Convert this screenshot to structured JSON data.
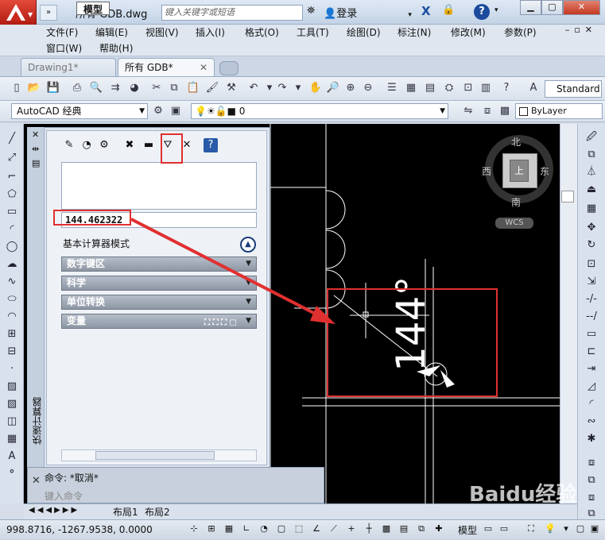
{
  "title_bar": {
    "doc_title": "所有 GDB.dwg",
    "search_placeholder": "键入关键字或短语",
    "login_label": "登录",
    "help_label": "?"
  },
  "menu": {
    "row1": [
      "文件(F)",
      "编辑(E)",
      "视图(V)",
      "插入(I)",
      "格式(O)",
      "工具(T)",
      "绘图(D)",
      "标注(N)",
      "修改(M)",
      "参数(P)"
    ],
    "row2": [
      "窗口(W)",
      "帮助(H)"
    ]
  },
  "tabs": [
    {
      "label": "Drawing1*"
    },
    {
      "label": "所有 GDB*"
    }
  ],
  "toolbar": {
    "text_style": "Standard",
    "workspace": "AutoCAD 经典",
    "layer": "0",
    "color": "ByLayer"
  },
  "calculator": {
    "palette_title": "快速计算器",
    "input_value": "144.462322",
    "mode_label": "基本计算器模式",
    "sections": [
      "数字键区",
      "科学",
      "单位转换",
      "变量"
    ]
  },
  "viewcube": {
    "north": "北",
    "south": "南",
    "east": "东",
    "west": "西",
    "face": "上",
    "wcs": "WCS"
  },
  "drawing": {
    "dimension_text": "144°"
  },
  "command_line": {
    "history": "命令: *取消*",
    "prompt": "键入命令"
  },
  "layout_tabs": [
    "模型",
    "布局1",
    "布局2"
  ],
  "status_bar": {
    "coordinates": "998.8716,  -1267.9538, 0.0000",
    "model_label": "模型"
  },
  "watermark": "Baidu经验"
}
